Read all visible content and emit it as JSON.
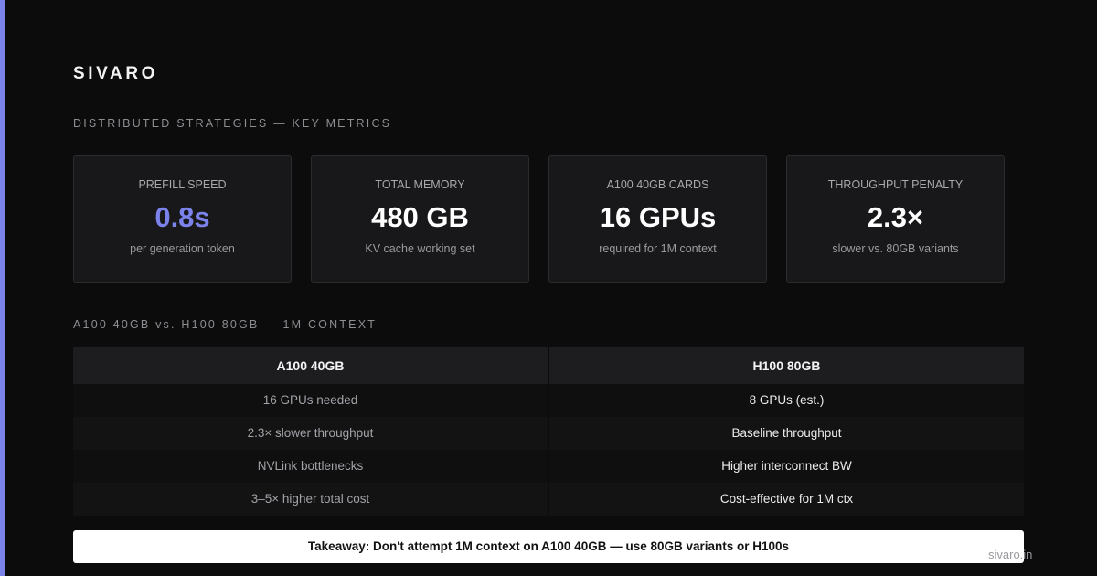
{
  "brand": "SIVARO",
  "metrics_label": "DISTRIBUTED STRATEGIES — KEY METRICS",
  "metrics": [
    {
      "title": "PREFILL SPEED",
      "value": "0.8s",
      "sub": "per generation token"
    },
    {
      "title": "TOTAL MEMORY",
      "value": "480 GB",
      "sub": "KV cache working set"
    },
    {
      "title": "A100 40GB CARDS",
      "value": "16 GPUs",
      "sub": "required for 1M context"
    },
    {
      "title": "THROUGHPUT PENALTY",
      "value": "2.3×",
      "sub": "slower vs. 80GB variants"
    }
  ],
  "comparison_label": "A100 40GB vs. H100 80GB — 1M CONTEXT",
  "comparison": {
    "left": {
      "header": "A100 40GB",
      "rows": [
        "16 GPUs needed",
        "2.3× slower throughput",
        "NVLink bottlenecks",
        "3–5× higher total cost"
      ]
    },
    "right": {
      "header": "H100 80GB",
      "rows": [
        "8 GPUs (est.)",
        "Baseline throughput",
        "Higher interconnect BW",
        "Cost-effective for 1M ctx"
      ]
    }
  },
  "takeaway": "Takeaway: Don't attempt 1M context on A100 40GB — use 80GB variants or H100s",
  "footer_domain": "sivaro.in",
  "colors": {
    "accent": "#7b83eb",
    "background": "#0c0c0d",
    "card": "#18181a"
  }
}
